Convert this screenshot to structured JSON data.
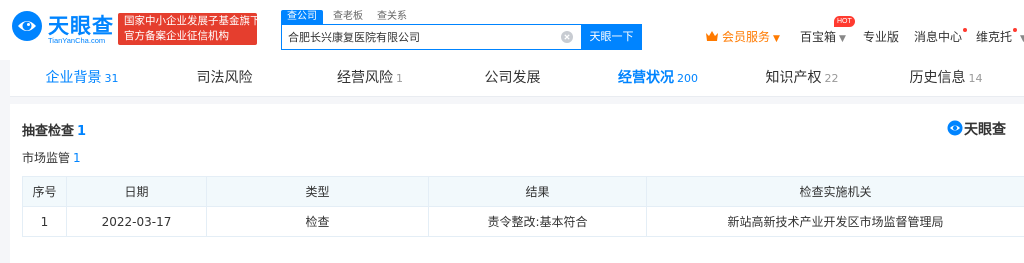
{
  "brand": {
    "name_cn": "天眼查",
    "domain": "TianYanCha.com",
    "gov_badge_line1": "国家中小企业发展子基金旗下",
    "gov_badge_line2": "官方备案企业征信机构"
  },
  "search": {
    "tabs": [
      "查公司",
      "查老板",
      "查关系"
    ],
    "value": "合肥长兴康复医院有限公司",
    "button": "天眼一下"
  },
  "nav": {
    "vip": "会员服务",
    "baibaoxiang": "百宝箱",
    "hot_badge": "HOT",
    "pro": "专业版",
    "messages": "消息中心",
    "user": "维克托"
  },
  "tabs": [
    {
      "label": "企业背景",
      "count": "31"
    },
    {
      "label": "司法风险",
      "count": ""
    },
    {
      "label": "经营风险",
      "count": "1"
    },
    {
      "label": "公司发展",
      "count": ""
    },
    {
      "label": "经营状况",
      "count": "200"
    },
    {
      "label": "知识产权",
      "count": "22"
    },
    {
      "label": "历史信息",
      "count": "14"
    }
  ],
  "section": {
    "title": "抽查检查",
    "count": "1",
    "sub_title": "市场监管",
    "sub_count": "1",
    "watermark": "天眼查"
  },
  "table": {
    "headers": [
      "序号",
      "日期",
      "类型",
      "结果",
      "检查实施机关"
    ],
    "rows": [
      [
        "1",
        "2022-03-17",
        "检查",
        "责令整改:基本符合",
        "新站高新技术产业开发区市场监督管理局"
      ]
    ]
  },
  "colors": {
    "accent": "#0084ff",
    "badge_red": "#e53e2e",
    "vip_orange": "#ff7a00",
    "table_header_bg": "#f2f9fc"
  }
}
